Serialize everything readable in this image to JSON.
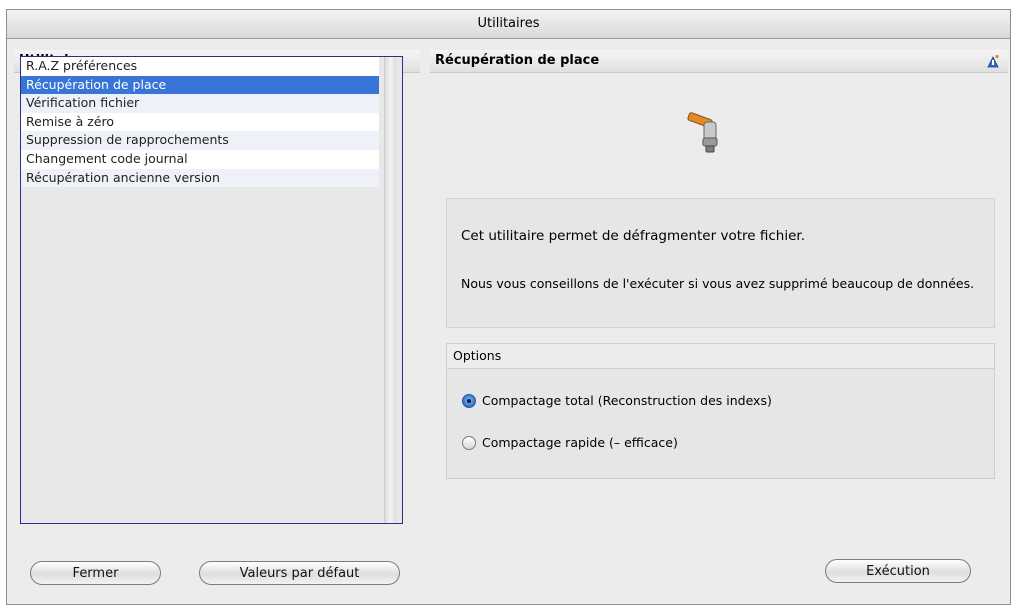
{
  "window": {
    "title": "Utilitaires"
  },
  "left_pane": {
    "header": "Utilitaires",
    "items": [
      {
        "label": "R.A.Z préférences"
      },
      {
        "label": "Récupération de place",
        "selected": true
      },
      {
        "label": "Vérification fichier"
      },
      {
        "label": "Remise à zéro"
      },
      {
        "label": "Suppression de rapprochements"
      },
      {
        "label": "Changement code journal"
      },
      {
        "label": "Récupération ancienne version"
      }
    ],
    "close_button": "Fermer",
    "defaults_button": "Valeurs par défaut"
  },
  "right_pane": {
    "header": "Récupération de place",
    "description_line1": "Cet utilitaire permet de défragmenter votre fichier.",
    "description_line2": "Nous vous conseillons de l'exécuter si vous avez supprimé beaucoup de données.",
    "options": {
      "title": "Options",
      "choices": [
        {
          "label": "Compactage total (Reconstruction des indexs)",
          "selected": true
        },
        {
          "label": "Compactage rapide (– efficace)",
          "selected": false
        }
      ]
    },
    "execute_button": "Exécution"
  },
  "colors": {
    "selection": "#3875d7",
    "list_border": "#2b2e8a",
    "window_bg": "#ececec"
  },
  "icons": {
    "right_header": "help-icon",
    "hero": "hammer-icon"
  }
}
